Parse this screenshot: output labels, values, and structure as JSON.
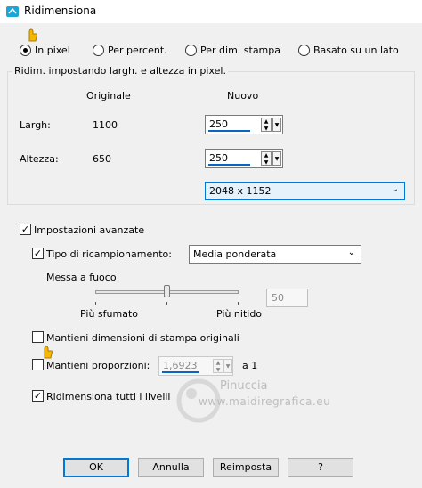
{
  "window": {
    "title": "Ridimensiona"
  },
  "mode": {
    "selected": "In pixel",
    "options": [
      "In pixel",
      "Per percent.",
      "Per dim. stampa",
      "Basato su un lato"
    ]
  },
  "pixel_group": {
    "title": "Ridim. impostando largh. e altezza in pixel.",
    "col_original": "Originale",
    "col_new": "Nuovo",
    "width_label": "Largh:",
    "width_original": "1100",
    "width_new": "250",
    "height_label": "Altezza:",
    "height_original": "650",
    "height_new": "250",
    "preset": "2048 x 1152"
  },
  "advanced": {
    "label": "Impostazioni avanzate",
    "resample_label": "Tipo di ricampionamento:",
    "resample_value": "Media ponderata",
    "focus_label": "Messa a fuoco",
    "blur_label": "Più sfumato",
    "sharp_label": "Più nitido",
    "focus_value": "50",
    "focus_fraction": 0.5
  },
  "options": {
    "keep_print_size": "Mantieni dimensioni di stampa originali",
    "keep_ratio": "Mantieni proporzioni:",
    "ratio_value": "1,6923",
    "ratio_suffix": "a 1",
    "resize_layers": "Ridimensiona tutti i livelli"
  },
  "buttons": {
    "ok": "OK",
    "cancel": "Annulla",
    "reset": "Reimposta",
    "help": "?"
  },
  "watermark": {
    "name": "Pinuccia",
    "site": "www.maidiregrafica.eu"
  },
  "colors": {
    "accent": "#0078d7",
    "highlight_blue": "#0a64c8",
    "pointer_yellow": "#f5b800"
  }
}
